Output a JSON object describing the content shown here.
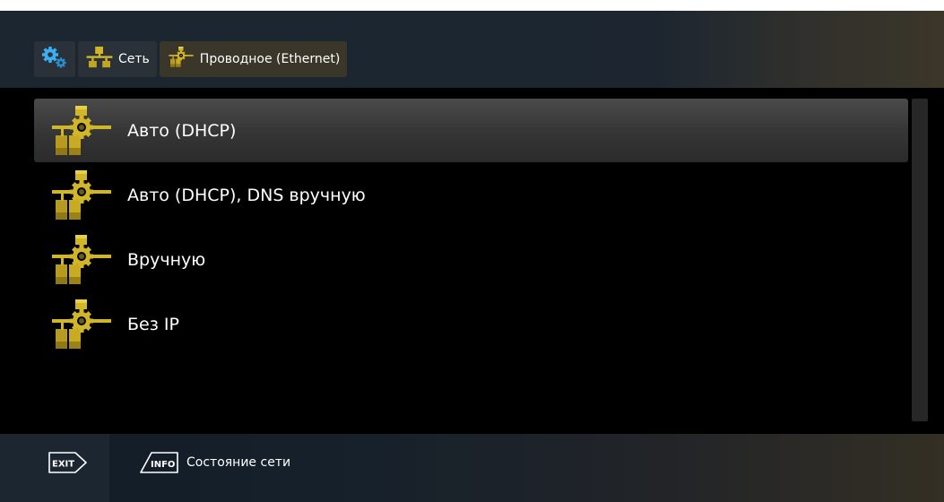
{
  "breadcrumb": {
    "items": [
      {
        "icon": "gear-icon"
      },
      {
        "icon": "network-icon",
        "label": "Сеть"
      },
      {
        "icon": "network-settings-icon",
        "label": "Проводное (Ethernet)"
      }
    ]
  },
  "menu": {
    "selected_index": 0,
    "items": [
      {
        "label": "Авто (DHCP)",
        "icon": "network-settings-icon"
      },
      {
        "label": "Авто (DHCP), DNS вручную",
        "icon": "network-settings-icon"
      },
      {
        "label": "Вручную",
        "icon": "network-settings-icon"
      },
      {
        "label": "Без IP",
        "icon": "network-settings-icon"
      }
    ]
  },
  "footer": {
    "exit_key": "EXIT",
    "info_key": "INFO",
    "info_label": "Состояние сети"
  },
  "colors": {
    "accent": "#d4b82a",
    "accent_dark": "#8e7b18",
    "gear": "#2fa5e6"
  }
}
